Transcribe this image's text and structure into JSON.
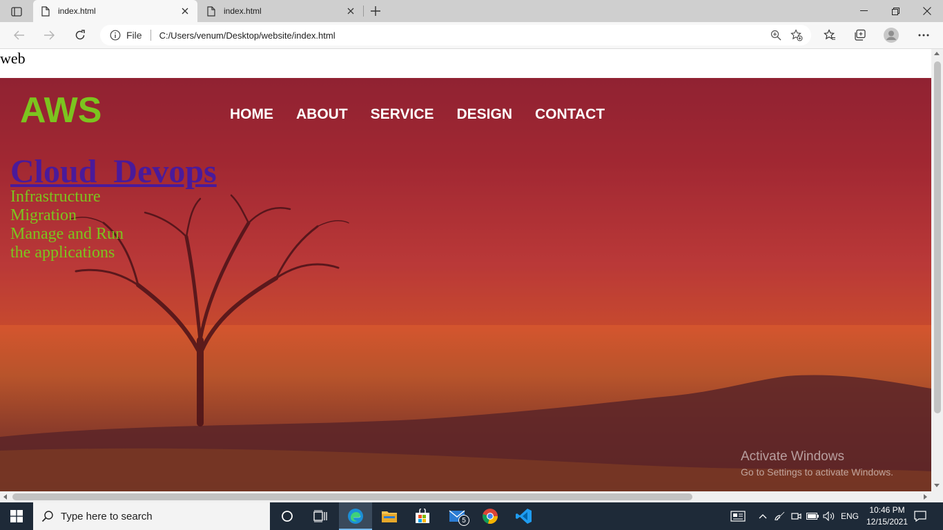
{
  "browser": {
    "tabs": [
      {
        "label": "index.html",
        "active": true
      },
      {
        "label": "index.html",
        "active": false
      }
    ],
    "address": {
      "scheme_label": "File",
      "url": "C:/Users/venum/Desktop/website/index.html"
    }
  },
  "page": {
    "top_text": "web",
    "brand": "AWS",
    "menu": [
      "HOME",
      "ABOUT",
      "SERVICE",
      "DESIGN",
      "CONTACT"
    ],
    "headline": "Cloud_Devops",
    "services": [
      "Infrastructure",
      "Migration",
      "Manage and Run",
      "the applications"
    ],
    "colors": {
      "brand": "#7cc41f",
      "headline": "#4a1a9a",
      "menu": "#ffffff"
    }
  },
  "watermark": {
    "title": "Activate Windows",
    "subtitle": "Go to Settings to activate Windows."
  },
  "taskbar": {
    "search_placeholder": "Type here to search",
    "mail_badge": "5",
    "language": "ENG",
    "time": "10:46 PM",
    "date": "12/15/2021"
  }
}
